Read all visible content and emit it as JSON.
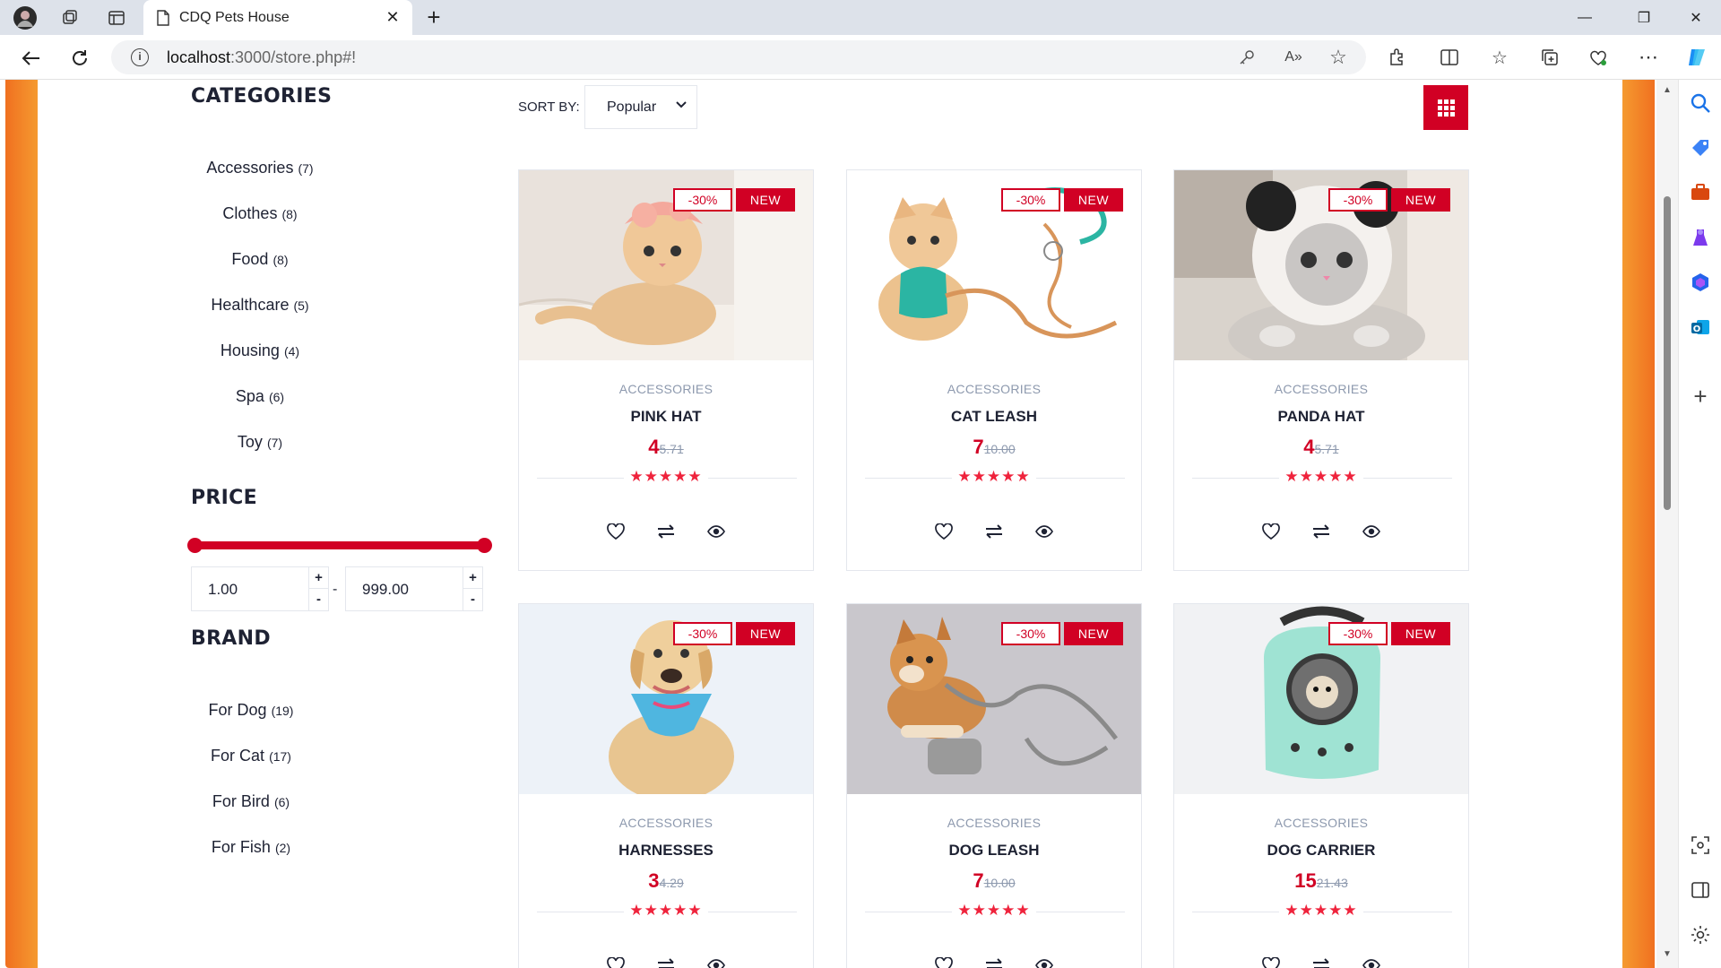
{
  "browser": {
    "tab_title": "CDQ Pets House",
    "url_host": "localhost",
    "url_rest": ":3000/store.php#!",
    "icons": [
      "avatar",
      "workspaces-icon",
      "tab-actions-icon",
      "page-icon",
      "close-icon",
      "plus-icon",
      "back-icon",
      "refresh-icon",
      "info-icon",
      "key-icon",
      "read-aloud-icon",
      "favorite-icon",
      "extensions-icon",
      "split-screen-icon",
      "favorites-icon",
      "collections-icon",
      "health-icon",
      "more-icon",
      "copilot-icon"
    ],
    "window": {
      "minimize": "—",
      "maximize": "❐",
      "close": "✕"
    }
  },
  "sidebar": {
    "categories_title": "CATEGORIES",
    "categories": [
      {
        "name": "Accessories",
        "count": "(7)"
      },
      {
        "name": "Clothes",
        "count": "(8)"
      },
      {
        "name": "Food",
        "count": "(8)"
      },
      {
        "name": "Healthcare",
        "count": "(5)"
      },
      {
        "name": "Housing",
        "count": "(4)"
      },
      {
        "name": "Spa",
        "count": "(6)"
      },
      {
        "name": "Toy",
        "count": "(7)"
      }
    ],
    "price_title": "PRICE",
    "price_min": "1.00",
    "price_max": "999.00",
    "price_dash": "-",
    "plus": "+",
    "minus": "-",
    "brand_title": "BRAND",
    "brands": [
      {
        "name": "For Dog",
        "count": "(19)"
      },
      {
        "name": "For Cat",
        "count": "(17)"
      },
      {
        "name": "For Bird",
        "count": "(6)"
      },
      {
        "name": "For Fish",
        "count": "(2)"
      }
    ]
  },
  "toolbar": {
    "sort_label": "SORT BY:",
    "sort_value": "Popular"
  },
  "products": [
    {
      "category": "ACCESSORIES",
      "name": "PINK HAT",
      "price": "4",
      "old_price": "5.71",
      "sale": "-30%",
      "new": "NEW",
      "stars": "★★★★★"
    },
    {
      "category": "ACCESSORIES",
      "name": "CAT LEASH",
      "price": "7",
      "old_price": "10.00",
      "sale": "-30%",
      "new": "NEW",
      "stars": "★★★★★"
    },
    {
      "category": "ACCESSORIES",
      "name": "PANDA HAT",
      "price": "4",
      "old_price": "5.71",
      "sale": "-30%",
      "new": "NEW",
      "stars": "★★★★★"
    },
    {
      "category": "ACCESSORIES",
      "name": "HARNESSES",
      "price": "3",
      "old_price": "4.29",
      "sale": "-30%",
      "new": "NEW",
      "stars": "★★★★★"
    },
    {
      "category": "ACCESSORIES",
      "name": "DOG LEASH",
      "price": "7",
      "old_price": "10.00",
      "sale": "-30%",
      "new": "NEW",
      "stars": "★★★★★"
    },
    {
      "category": "ACCESSORIES",
      "name": "DOG CARRIER",
      "price": "15",
      "old_price": "21.43",
      "sale": "-30%",
      "new": "NEW",
      "stars": "★★★★★"
    }
  ],
  "colors": {
    "accent": "#d10024",
    "side_stripe": "#f07020",
    "text_dark": "#1e2233",
    "text_muted": "#8d99ae"
  }
}
